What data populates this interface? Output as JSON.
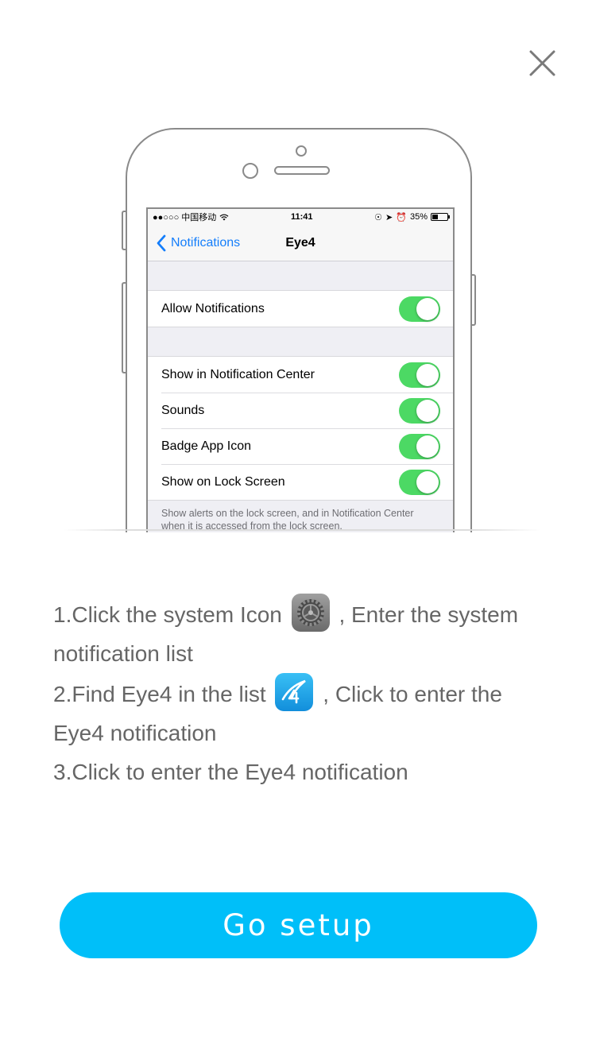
{
  "close_icon": "close-icon",
  "phone_screen": {
    "status_bar": {
      "carrier": "●●○○○ 中国移动",
      "time": "11:41",
      "battery": "35%"
    },
    "nav": {
      "back_label": "Notifications",
      "title": "Eye4"
    },
    "allow_row": {
      "label": "Allow Notifications",
      "toggle_on": true
    },
    "rows": [
      {
        "label": "Show in Notification Center",
        "toggle_on": true
      },
      {
        "label": "Sounds",
        "toggle_on": true
      },
      {
        "label": "Badge App Icon",
        "toggle_on": true
      },
      {
        "label": "Show on Lock Screen",
        "toggle_on": true
      }
    ],
    "footer_note": "Show alerts on the lock screen, and in Notification Center when it is accessed from the lock screen."
  },
  "instructions": {
    "step1_before": "1.Click the system Icon",
    "step1_after": ", Enter the system notification list",
    "step1_icon": "settings-icon",
    "step2_before": "2.Find Eye4 in the list",
    "step2_after": ", Click to enter the Eye4 notification",
    "step2_icon": "eye4-app-icon",
    "step3": "3.Click to enter the Eye4 notification"
  },
  "go_button_label": "Go setup",
  "colors": {
    "accent": "#00bff9",
    "toggle_on": "#4cd964",
    "ios_blue": "#147efb",
    "text": "#666666"
  }
}
